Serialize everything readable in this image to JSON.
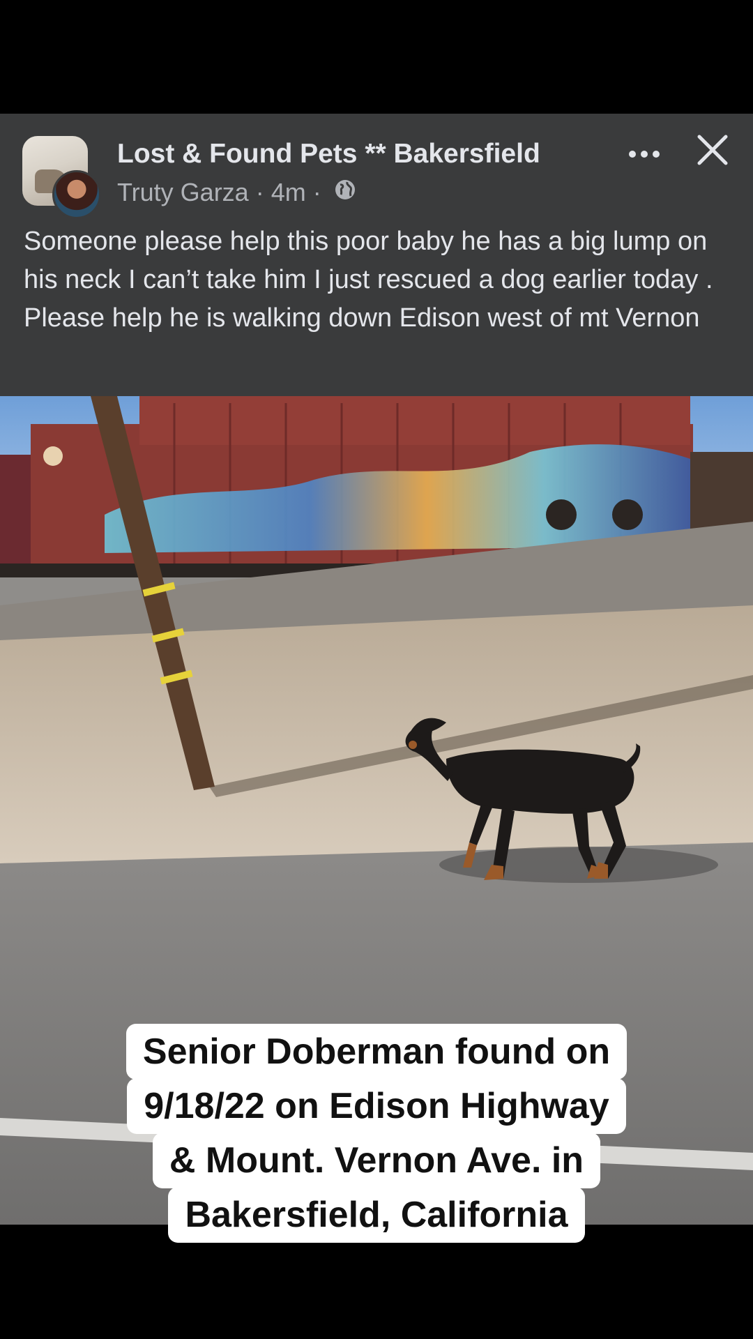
{
  "post": {
    "group_name": "Lost & Found Pets ** Bakersfield",
    "author": "Truty Garza",
    "separator": "·",
    "time": "4m",
    "visibility_icon": "globe-icon",
    "more_icon": "more-options-icon",
    "close_icon": "close-icon",
    "text": "Someone please help this poor baby he has a big lump on his neck I can’t take him I just rescued a dog earlier today . Please help he is walking down Edison west of mt Vernon"
  },
  "caption": {
    "lines": [
      "Senior Doberman found on",
      "9/18/22 on Edison Highway",
      "& Mount. Vernon Ave. in",
      "Bakersfield, California"
    ]
  },
  "colors": {
    "post_background": "#3a3b3c",
    "secondary_text": "#b0b3b8",
    "caption_background": "#ffffff"
  }
}
